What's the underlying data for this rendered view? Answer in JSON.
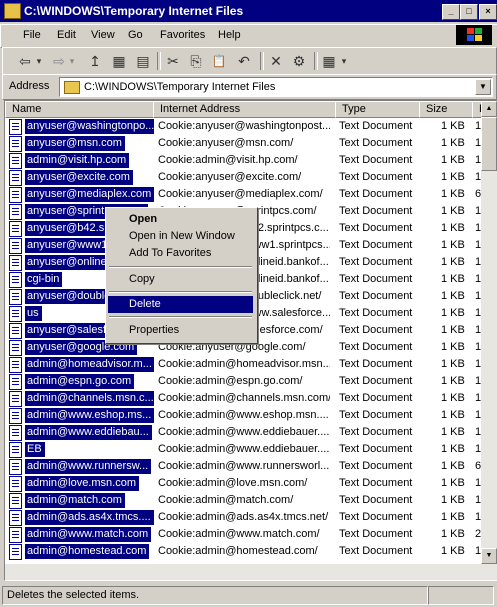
{
  "window": {
    "title": "C:\\WINDOWS\\Temporary Internet Files",
    "minimize": "_",
    "maximize": "□",
    "close": "×"
  },
  "menubar": {
    "items": [
      "File",
      "Edit",
      "View",
      "Go",
      "Favorites",
      "Help"
    ]
  },
  "toolbar": {
    "back": "⇦",
    "forward": "⇨",
    "up": "↥",
    "map": "▦",
    "disconnect": "▤",
    "cut": "✂",
    "copy": "⎘",
    "paste": "📋",
    "undo": "↶",
    "delete": "✕",
    "properties": "⚙",
    "views": "▦",
    "views_dd": "▾",
    "dd": "▾"
  },
  "addressbar": {
    "label": "Address",
    "value": "C:\\WINDOWS\\Temporary Internet Files"
  },
  "list": {
    "columns": [
      "Name",
      "Internet Address",
      "Type",
      "Size",
      "E"
    ],
    "rows": [
      {
        "name": "anyuser@washingtonpo...",
        "address": "Cookie:anyuser@washingtonpost...",
        "type": "Text Document",
        "size": "1 KB",
        "extra": "1"
      },
      {
        "name": "anyuser@msn.com",
        "address": "Cookie:anyuser@msn.com/",
        "type": "Text Document",
        "size": "1 KB",
        "extra": "1"
      },
      {
        "name": "admin@visit.hp.com",
        "address": "Cookie:admin@visit.hp.com/",
        "type": "Text Document",
        "size": "1 KB",
        "extra": "1"
      },
      {
        "name": "anyuser@excite.com",
        "address": "Cookie:anyuser@excite.com/",
        "type": "Text Document",
        "size": "1 KB",
        "extra": "1"
      },
      {
        "name": "anyuser@mediaplex.com",
        "address": "Cookie:anyuser@mediaplex.com/",
        "type": "Text Document",
        "size": "1 KB",
        "extra": "6"
      },
      {
        "name": "anyuser@sprintpcs.com",
        "address": "Cookie:anyuser@sprintpcs.com/",
        "type": "Text Document",
        "size": "1 KB",
        "extra": "1"
      },
      {
        "name": "anyuser@b42.sprintpcs...",
        "address": "Cookie:anyuser@b42.sprintpcs.c...",
        "type": "Text Document",
        "size": "1 KB",
        "extra": "1"
      },
      {
        "name": "anyuser@www1.sprintpcs...",
        "address": "Cookie:anyuser@www1.sprintpcs...",
        "type": "Text Document",
        "size": "1 KB",
        "extra": "1"
      },
      {
        "name": "anyuser@onlineid.bankof...",
        "address": "Cookie:anyuser@onlineid.bankof...",
        "type": "Text Document",
        "size": "1 KB",
        "extra": "1"
      },
      {
        "name": "cgi-bin",
        "address": "Cookie:anyuser@onlineid.bankof...",
        "type": "Text Document",
        "size": "1 KB",
        "extra": "1"
      },
      {
        "name": "anyuser@doubleclick.net",
        "address": "Cookie:anyuser@doubleclick.net/",
        "type": "Text Document",
        "size": "1 KB",
        "extra": "1"
      },
      {
        "name": "us",
        "address": "Cookie:anyuser@www.salesforce...",
        "type": "Text Document",
        "size": "1 KB",
        "extra": "1"
      },
      {
        "name": "anyuser@salesforce.com",
        "address": "Cookie:anyuser@salesforce.com/",
        "type": "Text Document",
        "size": "1 KB",
        "extra": "1"
      },
      {
        "name": "anyuser@google.com",
        "address": "Cookie:anyuser@google.com/",
        "type": "Text Document",
        "size": "1 KB",
        "extra": "1"
      },
      {
        "name": "admin@homeadvisor.m...",
        "address": "Cookie:admin@homeadvisor.msn....",
        "type": "Text Document",
        "size": "1 KB",
        "extra": "1"
      },
      {
        "name": "admin@espn.go.com",
        "address": "Cookie:admin@espn.go.com/",
        "type": "Text Document",
        "size": "1 KB",
        "extra": "1"
      },
      {
        "name": "admin@channels.msn.c...",
        "address": "Cookie:admin@channels.msn.com/",
        "type": "Text Document",
        "size": "1 KB",
        "extra": "1"
      },
      {
        "name": "admin@www.eshop.ms...",
        "address": "Cookie:admin@www.eshop.msn....",
        "type": "Text Document",
        "size": "1 KB",
        "extra": "1"
      },
      {
        "name": "admin@www.eddiebau...",
        "address": "Cookie:admin@www.eddiebauer....",
        "type": "Text Document",
        "size": "1 KB",
        "extra": "1"
      },
      {
        "name": "EB",
        "address": "Cookie:admin@www.eddiebauer....",
        "type": "Text Document",
        "size": "1 KB",
        "extra": "1"
      },
      {
        "name": "admin@www.runnersw...",
        "address": "Cookie:admin@www.runnersworl...",
        "type": "Text Document",
        "size": "1 KB",
        "extra": "6"
      },
      {
        "name": "admin@love.msn.com",
        "address": "Cookie:admin@love.msn.com/",
        "type": "Text Document",
        "size": "1 KB",
        "extra": "1"
      },
      {
        "name": "admin@match.com",
        "address": "Cookie:admin@match.com/",
        "type": "Text Document",
        "size": "1 KB",
        "extra": "1"
      },
      {
        "name": "admin@ads.as4x.tmcs....",
        "address": "Cookie:admin@ads.as4x.tmcs.net/",
        "type": "Text Document",
        "size": "1 KB",
        "extra": "1"
      },
      {
        "name": "admin@www.match.com",
        "address": "Cookie:admin@www.match.com/",
        "type": "Text Document",
        "size": "1 KB",
        "extra": "2"
      },
      {
        "name": "admin@homestead.com",
        "address": "Cookie:admin@homestead.com/",
        "type": "Text Document",
        "size": "1 KB",
        "extra": "1"
      }
    ]
  },
  "context_menu": {
    "items": [
      "Open",
      "Open in New Window",
      "Add To Favorites",
      "Copy",
      "Delete",
      "Properties"
    ],
    "selected": "Delete"
  },
  "statusbar": {
    "text": "Deletes the selected items."
  },
  "colors": {
    "selection": "#000080",
    "face": "#d4d0c8"
  }
}
